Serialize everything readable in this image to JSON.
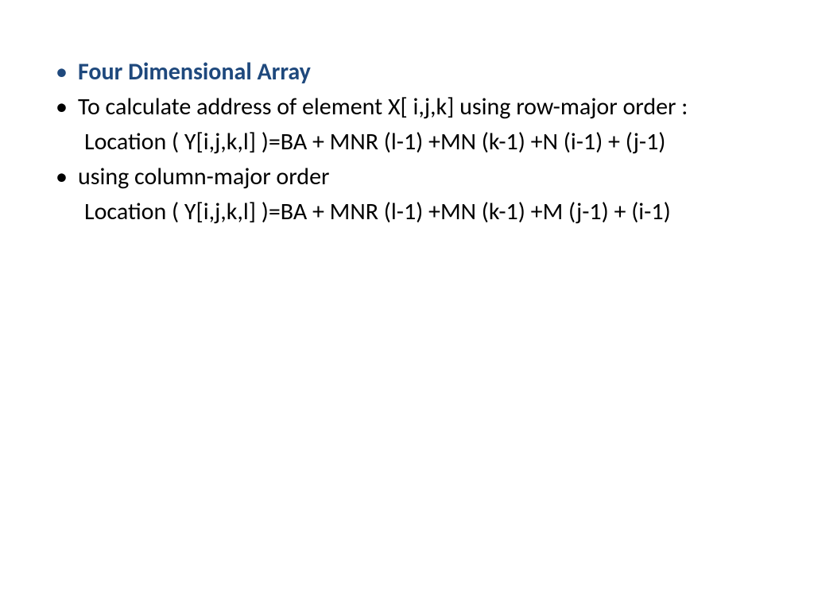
{
  "slide": {
    "title": "Four Dimensional Array",
    "line1": "To calculate address of element X[ i,j,k] using row-major order :",
    "formula1": "Location ( Y[i,j,k,l] )=BA + MNR (l-1) +MN (k-1) +N (i-1) + (j-1)",
    "line2": "using column-major order",
    "formula2": "Location ( Y[i,j,k,l] )=BA + MNR (l-1) +MN (k-1) +M (j-1) + (i-1)",
    "bullet": "•"
  },
  "colors": {
    "accent": "#1f497d",
    "body": "#000000"
  }
}
